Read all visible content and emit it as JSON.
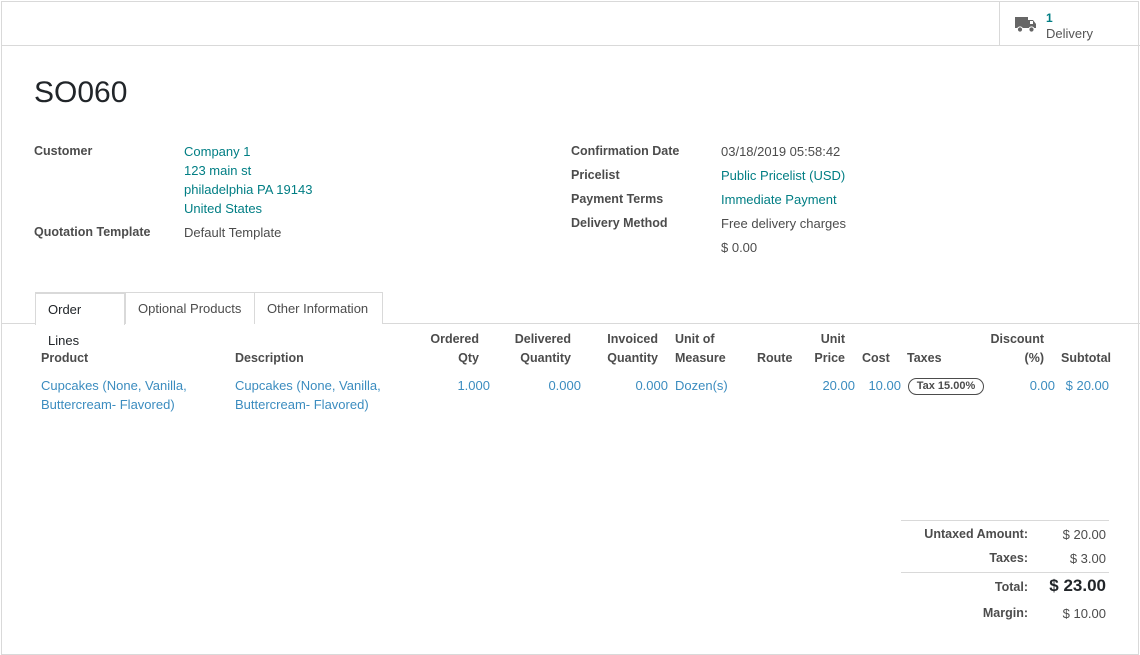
{
  "stat_button": {
    "count": "1",
    "label": "Delivery",
    "icon": "truck-icon"
  },
  "record": {
    "name": "SO060"
  },
  "left_fields": {
    "customer_label": "Customer",
    "customer_name": "Company 1",
    "customer_street": "123 main st",
    "customer_city": "philadelphia PA 19143",
    "customer_country": "United States",
    "template_label": "Quotation Template",
    "template_value": "Default Template"
  },
  "right_fields": {
    "confirmation_label": "Confirmation Date",
    "confirmation_value": "03/18/2019 05:58:42",
    "pricelist_label": "Pricelist",
    "pricelist_value": "Public Pricelist (USD)",
    "terms_label": "Payment Terms",
    "terms_value": "Immediate Payment",
    "delivery_label": "Delivery Method",
    "delivery_value": "Free delivery charges",
    "delivery_price": "$ 0.00"
  },
  "tabs": [
    {
      "label": "Order Lines",
      "active": true
    },
    {
      "label": "Optional Products",
      "active": false
    },
    {
      "label": "Other Information",
      "active": false
    }
  ],
  "columns": {
    "product": "Product",
    "description": "Description",
    "ordered_1": "Ordered",
    "ordered_2": "Qty",
    "delivered_1": "Delivered",
    "delivered_2": "Quantity",
    "invoiced_1": "Invoiced",
    "invoiced_2": "Quantity",
    "uom_1": "Unit of",
    "uom_2": "Measure",
    "route": "Route",
    "price_1": "Unit",
    "price_2": "Price",
    "cost": "Cost",
    "taxes": "Taxes",
    "discount_1": "Discount",
    "discount_2": "(%)",
    "subtotal": "Subtotal"
  },
  "line": {
    "product_1": "Cupcakes (None, Vanilla,",
    "product_2": "Buttercream- Flavored)",
    "description_1": "Cupcakes (None, Vanilla,",
    "description_2": "Buttercream- Flavored)",
    "ordered_qty": "1.000",
    "delivered_qty": "0.000",
    "invoiced_qty": "0.000",
    "uom": "Dozen(s)",
    "unit_price": "20.00",
    "cost": "10.00",
    "tax": "Tax 15.00%",
    "discount": "0.00",
    "subtotal": "$ 20.00"
  },
  "totals": {
    "untaxed_label": "Untaxed Amount:",
    "untaxed_value": "$ 20.00",
    "taxes_label": "Taxes:",
    "taxes_value": "$ 3.00",
    "total_label": "Total:",
    "total_value": "$ 23.00",
    "margin_label": "Margin:",
    "margin_value": "$ 10.00"
  }
}
